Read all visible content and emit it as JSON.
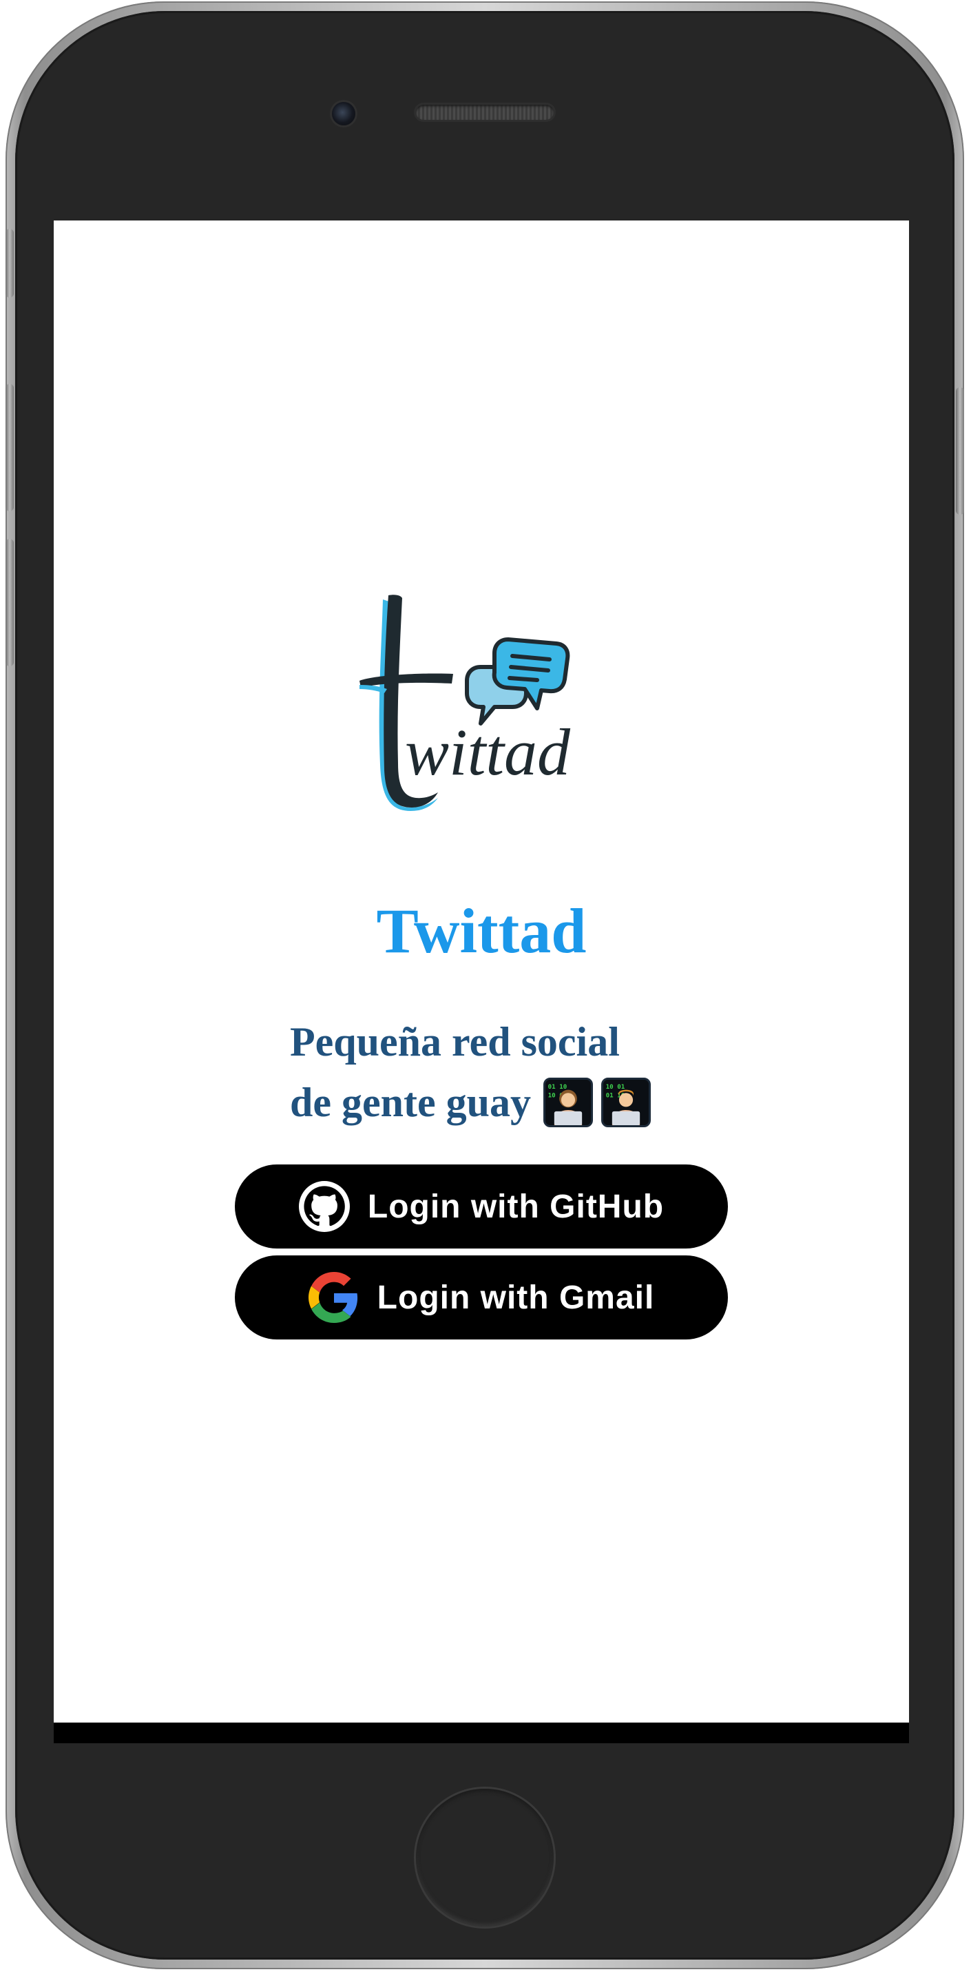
{
  "app": {
    "logo_text": "twittad",
    "title": "Twittad",
    "tagline_line1": "Pequeña red social",
    "tagline_line2": "de gente guay"
  },
  "tagline_emojis": [
    "woman-technologist-icon",
    "man-technologist-icon"
  ],
  "auth": {
    "github_label": "Login with GitHub",
    "gmail_label": "Login with Gmail"
  },
  "colors": {
    "title": "#1b98ea",
    "tagline": "#21527e",
    "button_bg": "#000000",
    "button_text": "#ffffff",
    "logo_accent": "#3bb7e6",
    "logo_dark": "#1f2a30"
  }
}
